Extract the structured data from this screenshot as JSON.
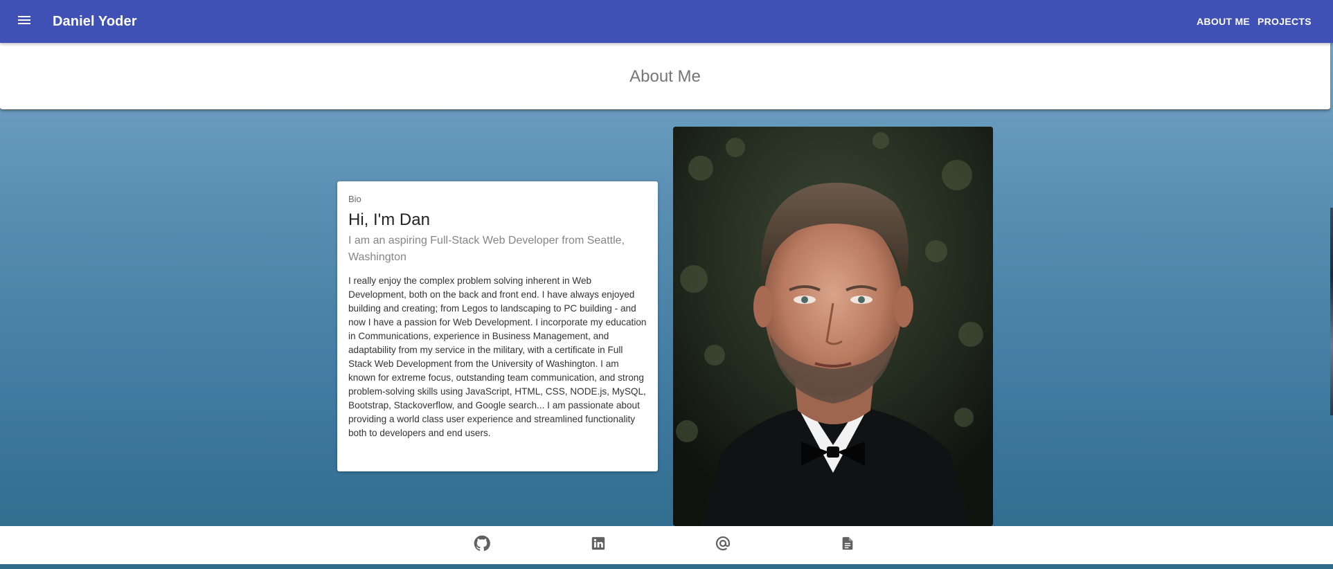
{
  "app_bar": {
    "title": "Daniel Yoder",
    "menu_icon": "hamburger-menu-icon",
    "nav": [
      {
        "label": "ABOUT ME"
      },
      {
        "label": "PROJECTS"
      }
    ],
    "color": "#3f51b5"
  },
  "page_header": {
    "title": "About Me"
  },
  "bio": {
    "overline": "Bio",
    "heading": "Hi, I'm Dan",
    "subtitle": "I am an aspiring Full-Stack Web Developer from Seattle, Washington",
    "body": "I really enjoy the complex problem solving inherent in Web Development, both on the back and front end. I have always enjoyed building and creating; from Legos to landscaping to PC building - and now I have a passion for Web Development. I incorporate my education in Communications, experience in Business Management, and adaptability from my service in the military, with a certificate in Full Stack Web Development from the University of Washington. I am known for extreme focus, outstanding team communication, and strong problem-solving skills using JavaScript, HTML, CSS, NODE.js, MySQL, Bootstrap, Stackoverflow, and Google search... I am passionate about providing a world class user experience and streamlined functionality both to developers and end users."
  },
  "photo": {
    "subject": "portrait"
  },
  "footer": {
    "icons": [
      {
        "name": "github-icon"
      },
      {
        "name": "linkedin-icon"
      },
      {
        "name": "at-sign-icon"
      },
      {
        "name": "document-icon"
      }
    ],
    "icon_color": "#616161"
  }
}
